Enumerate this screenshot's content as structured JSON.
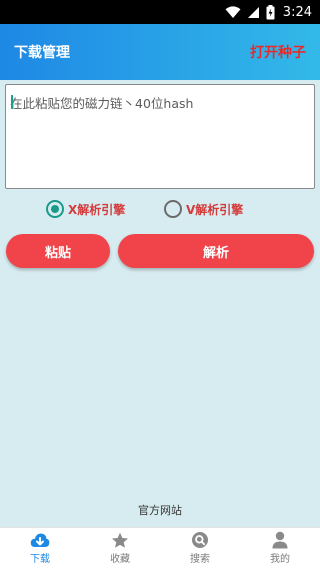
{
  "status_bar": {
    "time": "3:24",
    "icons": [
      "wifi-icon",
      "signal-icon",
      "battery-charging-icon"
    ]
  },
  "app_bar": {
    "title": "下载管理",
    "action": "打开种子"
  },
  "input": {
    "placeholder": "在此粘贴您的磁力链丶40位hash",
    "value": ""
  },
  "engines": [
    {
      "label": "X解析引擎",
      "selected": true
    },
    {
      "label": "V解析引擎",
      "selected": false
    }
  ],
  "buttons": {
    "paste": "粘贴",
    "parse": "解析"
  },
  "footer": {
    "official_site": "官方网站"
  },
  "tabs": [
    {
      "label": "下载",
      "icon": "cloud-download-icon",
      "active": true
    },
    {
      "label": "收藏",
      "icon": "star-icon",
      "active": false
    },
    {
      "label": "搜索",
      "icon": "search-icon",
      "active": false
    },
    {
      "label": "我的",
      "icon": "person-icon",
      "active": false
    }
  ],
  "colors": {
    "accent": "#1e88e5",
    "button": "#f0444a",
    "radio_selected": "#1a9a8a",
    "background": "#d7ecf1"
  }
}
